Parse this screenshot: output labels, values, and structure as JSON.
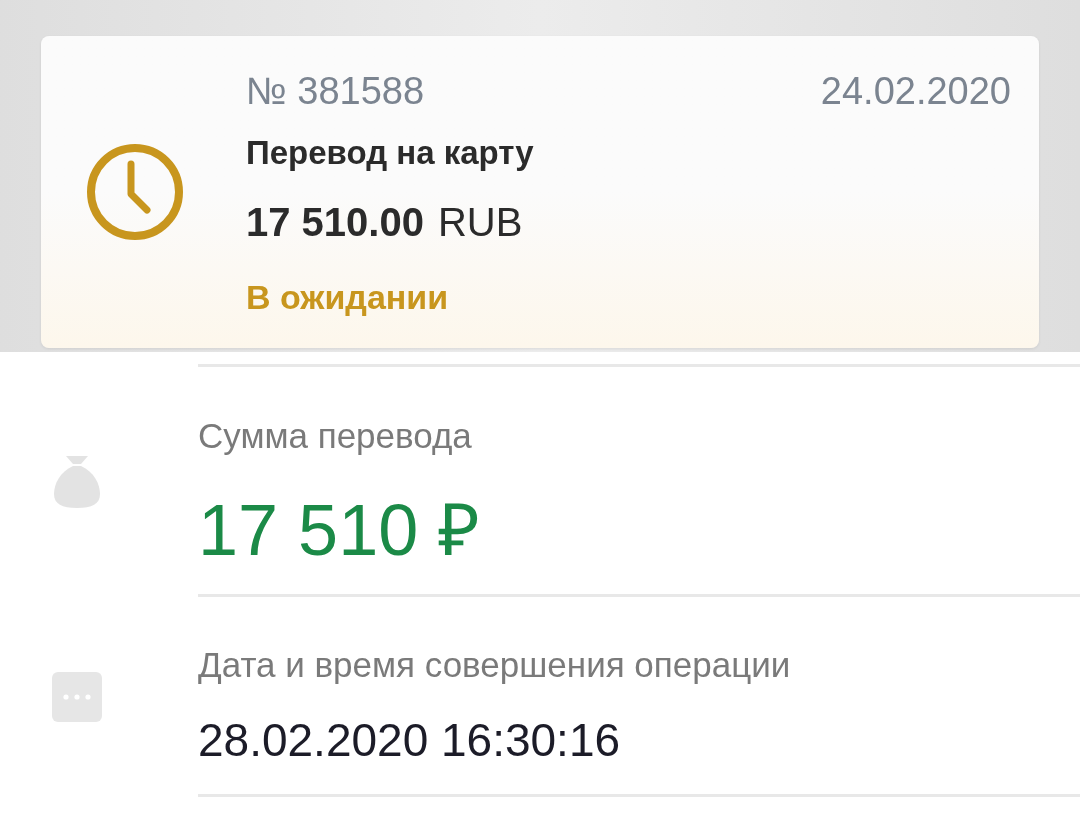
{
  "transaction": {
    "pending": true,
    "number": "№ 381588",
    "date": "24.02.2020",
    "title": "Перевод на карту",
    "amount": "17 510.00",
    "currency": "RUB",
    "status": "В ожидании"
  },
  "details": [
    {
      "kind": "amount",
      "label": "Сумма перевода",
      "value": "17 510 ₽"
    },
    {
      "kind": "datetime",
      "label": "Дата и время совершения операции",
      "value": "28.02.2020 16:30:16"
    }
  ]
}
